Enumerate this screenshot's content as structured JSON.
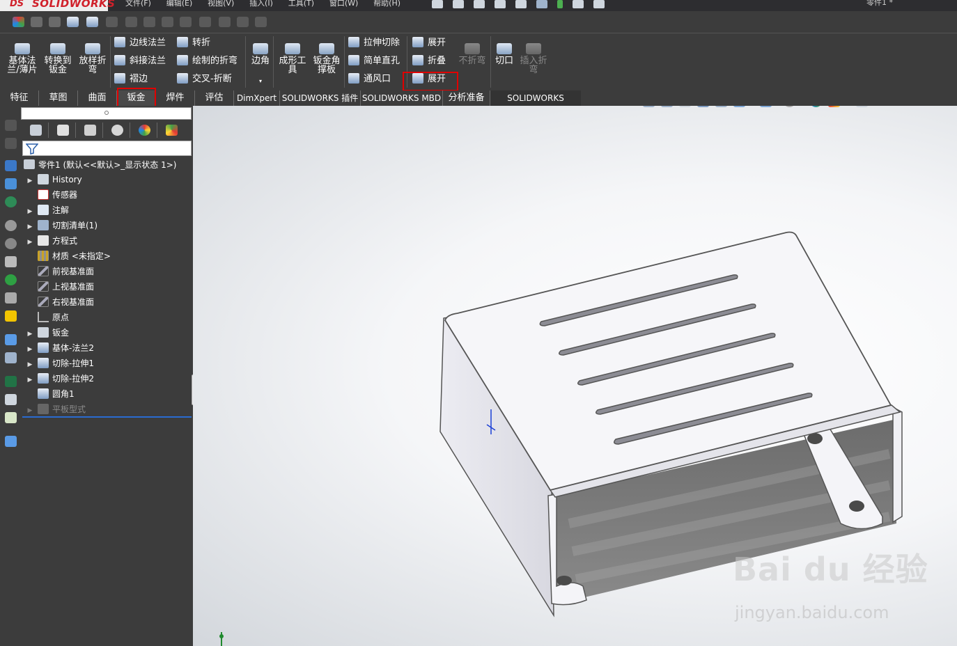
{
  "app": {
    "logo_ds": "DS",
    "logo_text": "SOLIDWORKS",
    "menu": [
      "文件(F)",
      "编辑(E)",
      "视图(V)",
      "插入(I)",
      "工具(T)",
      "窗口(W)",
      "帮助(H)"
    ],
    "document_title": "零件1 *"
  },
  "ribbon": {
    "base_flange": "基体法\n兰/薄片",
    "convert_to_sheet": "转换到\n钣金",
    "lofted_bend": "放样折\n弯",
    "edge_flange": "边线法兰",
    "miter_flange": "斜接法兰",
    "hem": "褶边",
    "jog": "转折",
    "sketched_bend": "绘制的折弯",
    "cross_break": "交叉-折断",
    "corners": "边角",
    "forming_tool": "成形工\n具",
    "sheet_metal_gusset": "钣金角\n撑板",
    "extruded_cut": "拉伸切除",
    "simple_hole": "简单直孔",
    "vent": "通风口",
    "unfold": "展开",
    "fold": "折叠",
    "no_bends": "不折弯",
    "flatten": "展开",
    "rip": "切口",
    "insert_bends": "插入折\n弯"
  },
  "tabs": [
    "特征",
    "草图",
    "曲面",
    "钣金",
    "焊件",
    "评估",
    "DimXpert",
    "SOLIDWORKS 插件",
    "SOLIDWORKS MBD",
    "分析准备",
    "SOLIDWORKS Plastics"
  ],
  "active_tab": "钣金",
  "feature_tree": {
    "root": "零件1  (默认<<默认>_显示状态 1>)",
    "items": [
      {
        "label": "History",
        "expandable": true
      },
      {
        "label": "传感器",
        "expandable": false
      },
      {
        "label": "注解",
        "expandable": true
      },
      {
        "label": "切割清单(1)",
        "expandable": true
      },
      {
        "label": "方程式",
        "expandable": true
      },
      {
        "label": "材质 <未指定>",
        "expandable": false
      },
      {
        "label": "前视基准面",
        "expandable": false
      },
      {
        "label": "上视基准面",
        "expandable": false
      },
      {
        "label": "右视基准面",
        "expandable": false
      },
      {
        "label": "原点",
        "expandable": false
      },
      {
        "label": "钣金",
        "expandable": true
      },
      {
        "label": "基体-法兰2",
        "expandable": true
      },
      {
        "label": "切除-拉伸1",
        "expandable": true
      },
      {
        "label": "切除-拉伸2",
        "expandable": true
      },
      {
        "label": "圆角1",
        "expandable": false
      },
      {
        "label": "平板型式",
        "expandable": true,
        "suppressed": true
      }
    ]
  },
  "watermark": {
    "brand": "Bai du 经验",
    "url": "jingyan.baidu.com"
  },
  "colors": {
    "ui_dark": "#3c3c3c",
    "highlight_box": "#e00000",
    "rollback_bar": "#2a6bd1"
  }
}
